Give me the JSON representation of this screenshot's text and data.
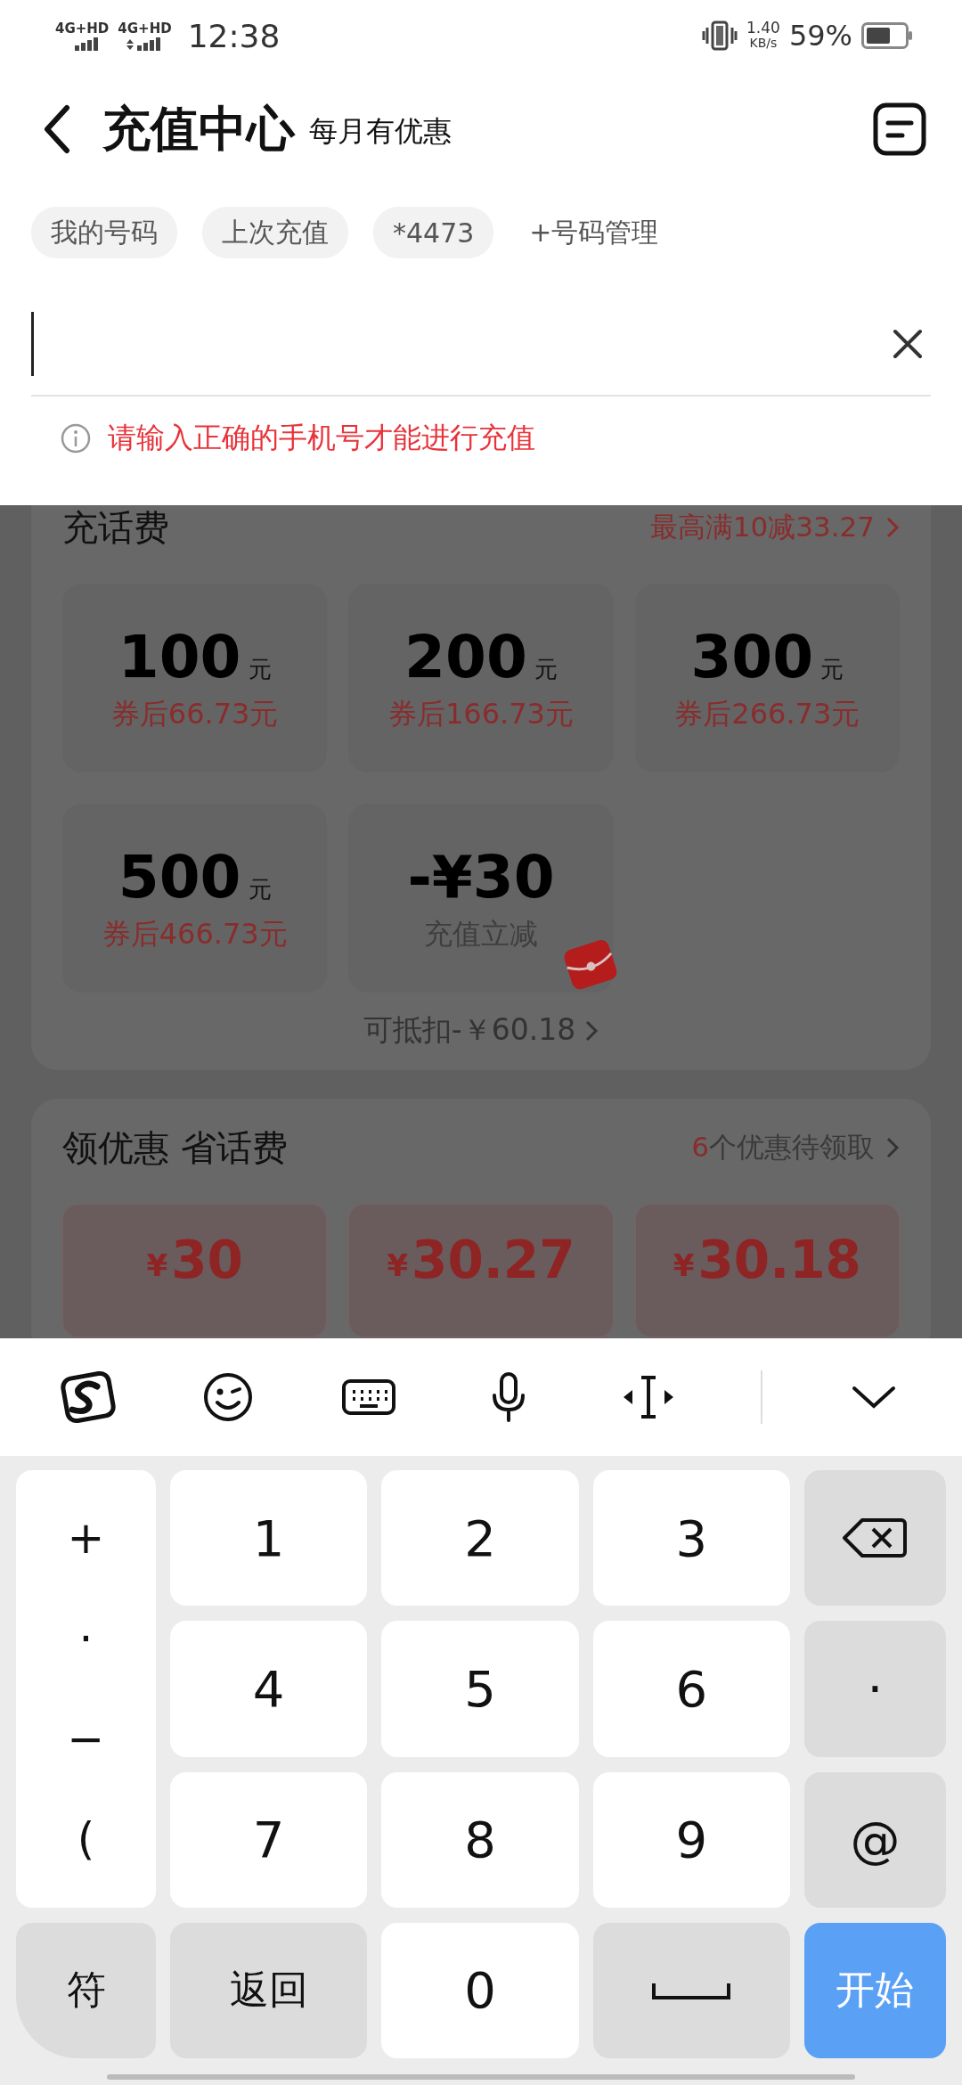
{
  "status_bar": {
    "networks": [
      "4G+HD",
      "4G+HD"
    ],
    "time": "12:38",
    "speed_value": "1.40",
    "speed_unit": "KB/s",
    "battery": "59%"
  },
  "header": {
    "title": "充值中心",
    "subtitle": "每月有优惠"
  },
  "chips": [
    {
      "label": "我的号码",
      "kind": "chip"
    },
    {
      "label": "上次充值",
      "kind": "chip"
    },
    {
      "label": "*4473",
      "kind": "chip"
    },
    {
      "label": "+号码管理",
      "kind": "link"
    }
  ],
  "error": "请输入正确的手机号才能进行充值",
  "recharge": {
    "title": "充话费",
    "promo": "最高满10减33.27",
    "tiles": [
      {
        "kind": "amount",
        "amount": "100",
        "unit": "元",
        "note": "券后66.73元"
      },
      {
        "kind": "amount",
        "amount": "200",
        "unit": "元",
        "note": "券后166.73元"
      },
      {
        "kind": "amount",
        "amount": "300",
        "unit": "元",
        "note": "券后266.73元"
      },
      {
        "kind": "amount",
        "amount": "500",
        "unit": "元",
        "note": "券后466.73元"
      },
      {
        "kind": "discount",
        "amount": "-¥30",
        "note": "充值立减"
      }
    ],
    "deduct": "可抵扣-￥60.18"
  },
  "coupons": {
    "title": "领优惠 省话费",
    "count": "6",
    "pending": "个优惠待领取",
    "items": [
      {
        "currency": "¥",
        "value": "30"
      },
      {
        "currency": "¥",
        "value": "30.27"
      },
      {
        "currency": "¥",
        "value": "30.18"
      }
    ]
  },
  "keyboard": {
    "symbols": [
      "+",
      "·",
      "−",
      "("
    ],
    "keys": [
      {
        "kind": "digit",
        "label": "1"
      },
      {
        "kind": "digit",
        "label": "2"
      },
      {
        "kind": "digit",
        "label": "3"
      },
      {
        "kind": "backspace"
      },
      {
        "kind": "digit",
        "label": "4"
      },
      {
        "kind": "digit",
        "label": "5"
      },
      {
        "kind": "digit",
        "label": "6"
      },
      {
        "kind": "function",
        "label": "·"
      },
      {
        "kind": "digit",
        "label": "7"
      },
      {
        "kind": "digit",
        "label": "8"
      },
      {
        "kind": "digit",
        "label": "9"
      },
      {
        "kind": "function",
        "label": "@"
      },
      {
        "kind": "function",
        "label": "符"
      },
      {
        "kind": "function",
        "label": "返回"
      },
      {
        "kind": "digit",
        "label": "0"
      },
      {
        "kind": "space"
      },
      {
        "kind": "primary",
        "label": "开始"
      }
    ]
  }
}
